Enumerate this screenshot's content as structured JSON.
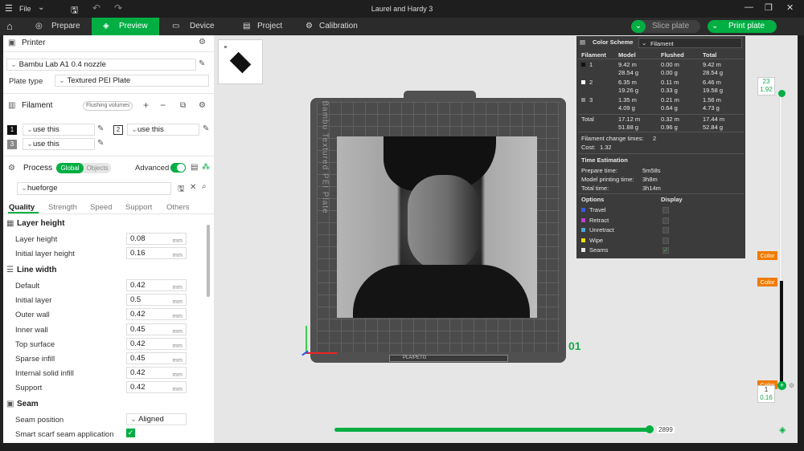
{
  "window": {
    "title": "Laurel and Hardy 3",
    "file_menu": "File"
  },
  "tabs": [
    {
      "label": "Prepare",
      "active": false
    },
    {
      "label": "Preview",
      "active": true
    },
    {
      "label": "Device",
      "active": false
    },
    {
      "label": "Project",
      "active": false
    },
    {
      "label": "Calibration",
      "active": false
    }
  ],
  "actions": {
    "slice": "Slice plate",
    "print": "Print plate"
  },
  "printer": {
    "section": "Printer",
    "model": "Bambu Lab A1 0.4 nozzle",
    "plate_type_label": "Plate type",
    "plate_type": "Textured PEI Plate"
  },
  "filament": {
    "section": "Filament",
    "flushing_button": "Flushing volumes",
    "slots": [
      {
        "num": "1",
        "value": "use this",
        "color": "#111111"
      },
      {
        "num": "2",
        "value": "use this",
        "color": "#ffffff"
      },
      {
        "num": "3",
        "value": "use this",
        "color": "#888888"
      }
    ]
  },
  "process": {
    "section": "Process",
    "toggle_global": "Global",
    "toggle_objects": "Objects",
    "advanced_label": "Advanced",
    "preset": "hueforge",
    "subtabs": [
      "Quality",
      "Strength",
      "Speed",
      "Support",
      "Others"
    ],
    "active_subtab": "Quality"
  },
  "groups": {
    "layer_height": {
      "title": "Layer height",
      "params": [
        {
          "label": "Layer height",
          "value": "0.08",
          "unit": "mm"
        },
        {
          "label": "Initial layer height",
          "value": "0.16",
          "unit": "mm"
        }
      ]
    },
    "line_width": {
      "title": "Line width",
      "params": [
        {
          "label": "Default",
          "value": "0.42",
          "unit": "mm"
        },
        {
          "label": "Initial layer",
          "value": "0.5",
          "unit": "mm"
        },
        {
          "label": "Outer wall",
          "value": "0.42",
          "unit": "mm"
        },
        {
          "label": "Inner wall",
          "value": "0.45",
          "unit": "mm"
        },
        {
          "label": "Top surface",
          "value": "0.42",
          "unit": "mm"
        },
        {
          "label": "Sparse infill",
          "value": "0.45",
          "unit": "mm"
        },
        {
          "label": "Internal solid infill",
          "value": "0.42",
          "unit": "mm"
        },
        {
          "label": "Support",
          "value": "0.42",
          "unit": "mm"
        }
      ]
    },
    "seam": {
      "title": "Seam",
      "position_label": "Seam position",
      "position_value": "Aligned",
      "scarf_label": "Smart scarf seam application",
      "scarf_checked": true
    }
  },
  "plate": {
    "number": "01",
    "side_text": "Bambu Textured PEI Plate",
    "bottom_text": "PLA/PETG"
  },
  "color_scheme": {
    "title": "Color Scheme",
    "mode": "Filament",
    "headers": [
      "Filament",
      "Model",
      "Flushed",
      "Total"
    ],
    "rows": [
      {
        "id": "1",
        "swatch": "#111111",
        "model_m": "9.42 m",
        "model_g": "28.54 g",
        "flushed_m": "0.00 m",
        "flushed_g": "0.00 g",
        "total_m": "9.42 m",
        "total_g": "28.54 g"
      },
      {
        "id": "2",
        "swatch": "#ffffff",
        "model_m": "6.35 m",
        "model_g": "19.26 g",
        "flushed_m": "0.11 m",
        "flushed_g": "0.33 g",
        "total_m": "6.46 m",
        "total_g": "19.58 g"
      },
      {
        "id": "3",
        "swatch": "#888888",
        "model_m": "1.35 m",
        "model_g": "4.09 g",
        "flushed_m": "0.21 m",
        "flushed_g": "0.64 g",
        "total_m": "1.56 m",
        "total_g": "4.73 g"
      }
    ],
    "total": {
      "label": "Total",
      "model_m": "17.12 m",
      "model_g": "51.88 g",
      "flushed_m": "0.32 m",
      "flushed_g": "0.96 g",
      "total_m": "17.44 m",
      "total_g": "52.84 g"
    },
    "change_times_label": "Filament change times:",
    "change_times": "2",
    "cost_label": "Cost:",
    "cost": "1.32",
    "time_title": "Time Estimation",
    "prepare_label": "Prepare time:",
    "prepare": "5m58s",
    "model_time_label": "Model printing time:",
    "model_time": "3h8m",
    "total_time_label": "Total time:",
    "total_time": "3h14m",
    "options_title": "Options",
    "display_title": "Display",
    "options": [
      {
        "label": "Travel",
        "color": "#3a5bd9",
        "checked": false
      },
      {
        "label": "Retract",
        "color": "#c43cd6",
        "checked": false
      },
      {
        "label": "Unretract",
        "color": "#4aa8d8",
        "checked": false
      },
      {
        "label": "Wipe",
        "color": "#f0e000",
        "checked": false
      },
      {
        "label": "Seams",
        "color": "#e8e8e8",
        "checked": true
      }
    ]
  },
  "layer_slider": {
    "top_layer": "23",
    "top_height": "1.92",
    "bottom_layer": "1",
    "bottom_height": "0.16",
    "color_tag": "Color"
  },
  "move_slider": {
    "value": "2899"
  },
  "colors": {
    "accent": "#00ae42",
    "orange": "#f07b00",
    "panel_dark": "#3b3b3b"
  }
}
